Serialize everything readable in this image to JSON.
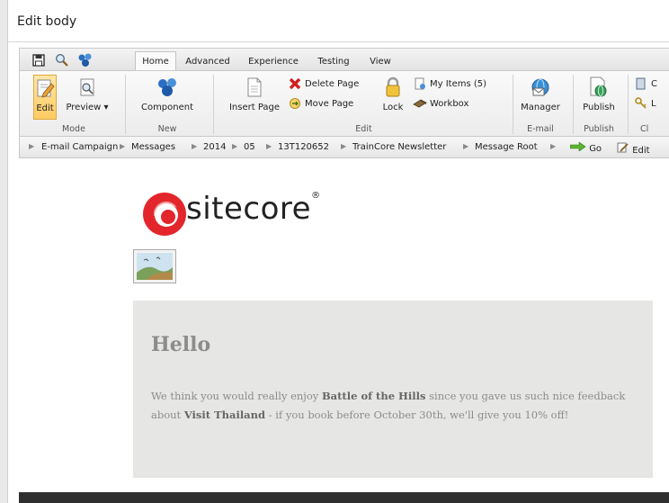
{
  "window": {
    "title": "Edit body"
  },
  "tabs": [
    "Home",
    "Advanced",
    "Experience",
    "Testing",
    "View"
  ],
  "quick_access": [
    "save-icon",
    "search-icon",
    "sitecore-cubes-icon"
  ],
  "groups": {
    "mode": {
      "label": "Mode",
      "edit": "Edit",
      "preview": "Preview ▾"
    },
    "new": {
      "label": "New",
      "component": "Component"
    },
    "edit": {
      "label": "Edit",
      "insert_page": "Insert Page",
      "delete_page": "Delete Page",
      "move_page": "Move Page",
      "lock": "Lock",
      "my_items": "My Items (5)",
      "workbox": "Workbox"
    },
    "email": {
      "label": "E-mail",
      "manager": "Manager"
    },
    "publish": {
      "label": "Publish",
      "publish": "Publish"
    },
    "cut": {
      "label": "Cl",
      "btn1": "C",
      "btn2": "L"
    }
  },
  "breadcrumb": [
    "E-mail Campaign",
    "Messages",
    "2014",
    "05",
    "13T120652",
    "TrainCore Newsletter",
    "Message Root"
  ],
  "breadcrumb_actions": {
    "go": "Go",
    "edit": "Edit"
  },
  "content": {
    "logo_text": "sitecore",
    "logo_mark": "®",
    "heading": "Hello",
    "p1": "We think you would really enjoy ",
    "b1": "Battle of the Hills",
    "p2": " since you gave us such nice feedback about ",
    "b2": "Visit Thailand",
    "p3": " - if you book before October 30th, we'll give you 10% off!"
  }
}
